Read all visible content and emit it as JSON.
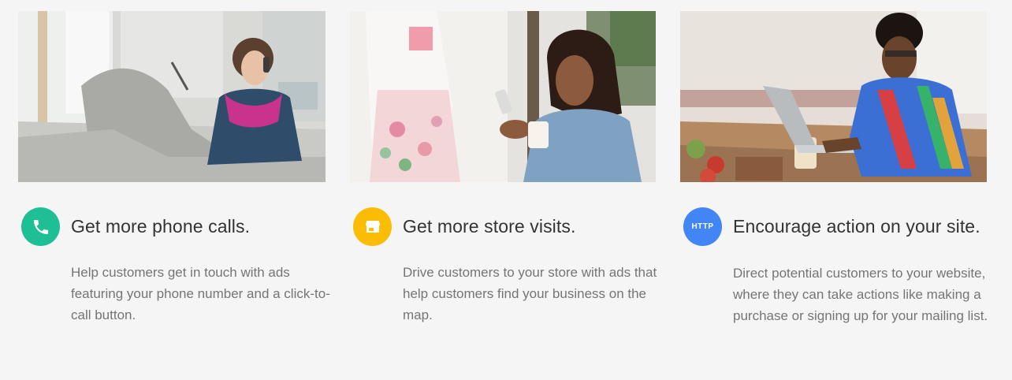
{
  "features": [
    {
      "heading": "Get more phone calls.",
      "description": "Help customers get in touch with ads featuring your phone number and a click-to-call button.",
      "icon": "phone-icon",
      "icon_color": "#1fbf96",
      "photo": "woman on phone on sofa"
    },
    {
      "heading": "Get more store visits.",
      "description": "Drive customers to your store with ads that help customers find your business on the map.",
      "icon": "storefront-icon",
      "icon_color": "#fbbc04",
      "photo": "woman with phone by store window"
    },
    {
      "heading": "Encourage action on your site.",
      "description": "Direct potential customers to your website, where they can take actions like making a purchase or signing up for your mailing list.",
      "icon": "http-icon",
      "icon_label": "HTTP",
      "icon_color": "#4285f4",
      "photo": "man working on laptop"
    }
  ]
}
